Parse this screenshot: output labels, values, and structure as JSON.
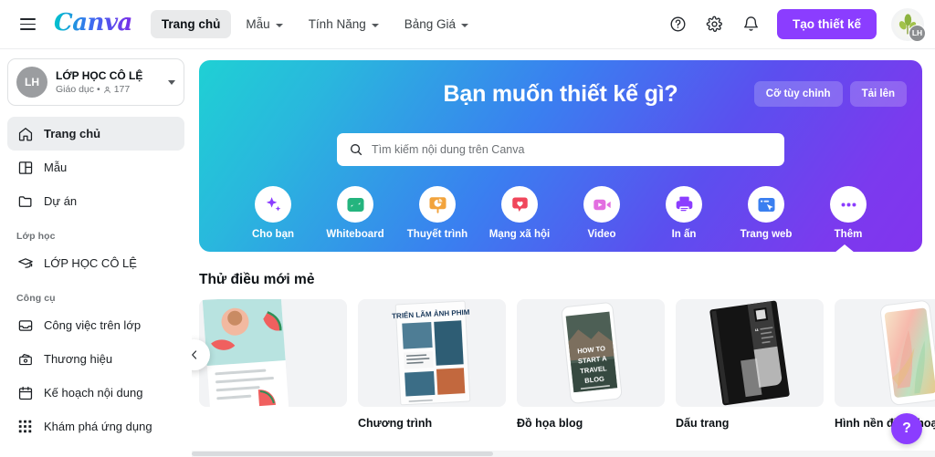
{
  "topbar": {
    "menu_icon": "hamburger-icon",
    "logo_text": "Canva",
    "nav": [
      {
        "label": "Trang chủ",
        "has_caret": false,
        "active": true
      },
      {
        "label": "Mẫu",
        "has_caret": true,
        "active": false
      },
      {
        "label": "Tính Năng",
        "has_caret": true,
        "active": false
      },
      {
        "label": "Bảng Giá",
        "has_caret": true,
        "active": false
      }
    ],
    "help_icon": "question-circle-icon",
    "settings_icon": "gear-icon",
    "notifications_icon": "bell-icon",
    "create_button": "Tạo thiết kế",
    "avatar_badge": "LH"
  },
  "sidebar": {
    "team": {
      "initials": "LH",
      "name": "LỚP HỌC CÔ LỆ",
      "type": "Giáo dục",
      "separator": "•",
      "members_icon": "person-icon",
      "members": "177"
    },
    "primary_items": [
      {
        "label": "Trang chủ",
        "icon": "home-icon",
        "active": true
      },
      {
        "label": "Mẫu",
        "icon": "template-icon",
        "active": false
      },
      {
        "label": "Dự án",
        "icon": "folder-icon",
        "active": false
      }
    ],
    "groups": [
      {
        "label": "Lớp học",
        "items": [
          {
            "label": "LỚP HỌC CÔ LỆ",
            "icon": "graduation-cap-icon"
          }
        ]
      },
      {
        "label": "Công cụ",
        "items": [
          {
            "label": "Công việc trên lớp",
            "icon": "inbox-icon"
          },
          {
            "label": "Thương hiệu",
            "icon": "brand-kit-icon"
          },
          {
            "label": "Kế hoạch nội dung",
            "icon": "calendar-icon"
          },
          {
            "label": "Khám phá ứng dụng",
            "icon": "apps-grid-icon"
          }
        ]
      }
    ]
  },
  "hero": {
    "title": "Bạn muốn thiết kế gì?",
    "actions": [
      {
        "label": "Cỡ tùy chỉnh"
      },
      {
        "label": "Tải lên"
      }
    ],
    "search": {
      "placeholder": "Tìm kiếm nội dung trên Canva",
      "value": "",
      "icon": "search-icon"
    },
    "categories": [
      {
        "label": "Cho bạn",
        "icon": "sparkle-icon",
        "color": "#8b3dff"
      },
      {
        "label": "Whiteboard",
        "icon": "whiteboard-icon",
        "color": "#24b47e"
      },
      {
        "label": "Thuyết trình",
        "icon": "presentation-icon",
        "color": "#f2a33c"
      },
      {
        "label": "Mạng xã hội",
        "icon": "social-heart-icon",
        "color": "#f0465b"
      },
      {
        "label": "Video",
        "icon": "video-camera-icon",
        "color": "#e26fe0"
      },
      {
        "label": "In ấn",
        "icon": "printer-icon",
        "color": "#8b3dff"
      },
      {
        "label": "Trang web",
        "icon": "website-cursor-icon",
        "color": "#3a7ff0"
      },
      {
        "label": "Thêm",
        "icon": "ellipsis-icon",
        "color": "#8b3dff"
      }
    ],
    "gradient_from": "#1fd0d4",
    "gradient_to": "#8234ee"
  },
  "section": {
    "title": "Thử điều mới mẻ",
    "prev_icon": "chevron-left-icon",
    "cards": [
      {
        "label": "",
        "art": "flyer",
        "partial": true
      },
      {
        "label": "Chương trình",
        "art": "program",
        "art_text": "TRIỂN LÃM ẢNH PHIM"
      },
      {
        "label": "Đồ họa blog",
        "art": "phone-blog",
        "art_text": "HOW TO START A TRAVEL BLOG"
      },
      {
        "label": "Dấu trang",
        "art": "bookmark"
      },
      {
        "label": "Hình nền điện thoại",
        "art": "wallpaper"
      }
    ]
  },
  "help_fab": {
    "label": "?",
    "color": "#8b3dff"
  },
  "scrollbar": {
    "orientation": "horizontal"
  }
}
